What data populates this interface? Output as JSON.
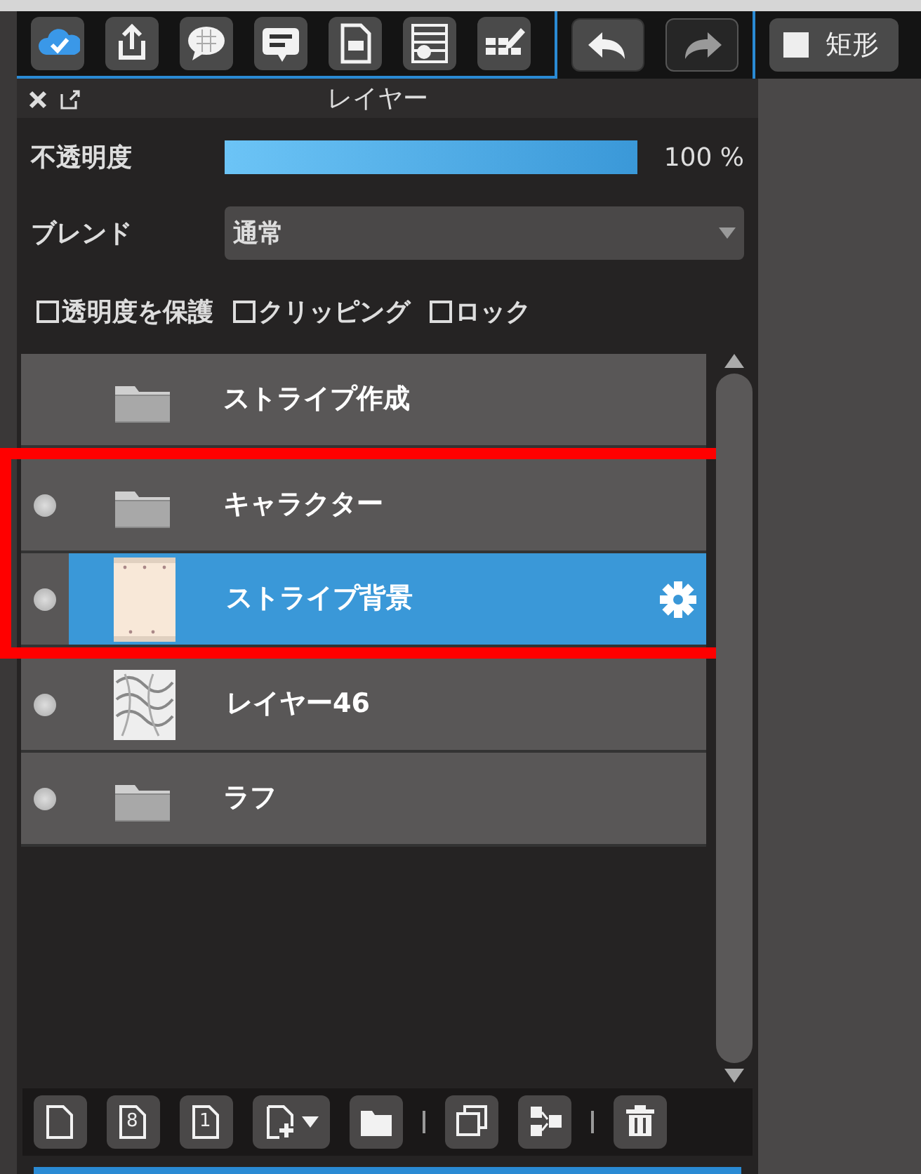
{
  "toolbar": {
    "tools": [
      {
        "kind": "cloud"
      },
      {
        "kind": "share"
      },
      {
        "kind": "speech"
      },
      {
        "kind": "comment"
      },
      {
        "kind": "page"
      },
      {
        "kind": "material"
      },
      {
        "kind": "edit"
      }
    ],
    "history": [
      {
        "kind": "undo",
        "disabled": false
      },
      {
        "kind": "redo",
        "disabled": true
      }
    ],
    "shape_button": {
      "label": "矩形"
    }
  },
  "panel": {
    "title": "レイヤー",
    "opacity": {
      "label": "不透明度",
      "level": 1.0,
      "reading": "100 %"
    },
    "blend": {
      "label": "ブレンド",
      "value": "通常"
    },
    "options": [
      {
        "label": "透明度を保護",
        "checked": false
      },
      {
        "label": "クリッピング",
        "checked": false
      },
      {
        "label": "ロック",
        "checked": false
      }
    ],
    "layers": [
      {
        "name": "ストライプ作成",
        "kind": "folder",
        "visible": false,
        "selected": false,
        "highlighted": false
      },
      {
        "name": "キャラクター",
        "kind": "folder",
        "visible": true,
        "selected": false,
        "highlighted": true
      },
      {
        "name": "ストライプ背景",
        "visible": true,
        "selected": true,
        "highlighted": true
      },
      {
        "name": "レイヤー46",
        "kind": "sketch",
        "visible": true,
        "selected": false,
        "highlighted": false
      },
      {
        "name": "ラフ",
        "kind": "folder",
        "visible": true,
        "selected": false,
        "highlighted": false
      }
    ],
    "bottom_buttons": [
      {
        "kind": "new-page"
      },
      {
        "kind": "page-8",
        "glyph": "8"
      },
      {
        "kind": "page-1",
        "glyph": "1"
      },
      {
        "kind": "add-page"
      },
      {
        "kind": "folder"
      },
      {
        "kind": "separator"
      },
      {
        "kind": "duplicate"
      },
      {
        "kind": "merge"
      },
      {
        "kind": "separator"
      },
      {
        "kind": "trash"
      }
    ]
  }
}
